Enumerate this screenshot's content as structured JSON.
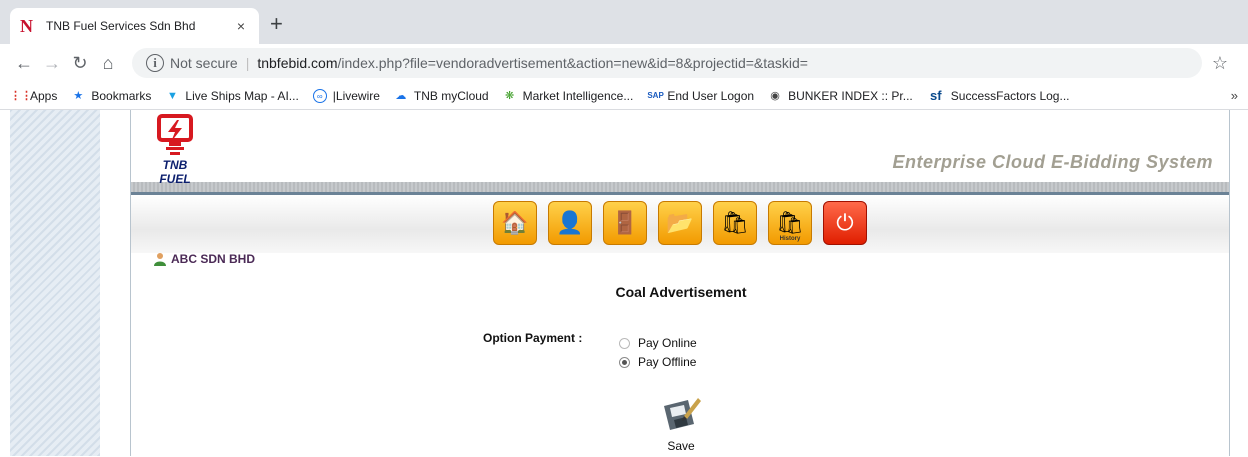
{
  "browser": {
    "tab_title": "TNB Fuel Services Sdn Bhd",
    "tab_favicon": "N",
    "close_glyph": "×",
    "newtab_glyph": "+",
    "security_label": "Not secure",
    "url_host": "tnbfebid.com",
    "url_path": "/index.php?file=vendoradvertisement&action=new&id=8&projectid=&taskid=",
    "bookmarks": [
      {
        "label": "Apps",
        "icon": "apps-grid-icon"
      },
      {
        "label": "Bookmarks",
        "icon": "star-icon"
      },
      {
        "label": "Live Ships Map - AI...",
        "icon": "ship-icon"
      },
      {
        "label": "|Livewire",
        "icon": "livewire-icon"
      },
      {
        "label": "TNB myCloud",
        "icon": "cloud-icon"
      },
      {
        "label": "Market Intelligence...",
        "icon": "market-icon"
      },
      {
        "label": "End User Logon",
        "icon": "sap-icon"
      },
      {
        "label": "BUNKER INDEX :: Pr...",
        "icon": "globe-icon"
      },
      {
        "label": "SuccessFactors Log...",
        "icon": "sf-icon"
      }
    ],
    "more_glyph": "»"
  },
  "header": {
    "brand": "TNB FUEL",
    "system_title": "Enterprise Cloud E-Bidding System"
  },
  "menu": [
    {
      "name": "home-icon",
      "glyph": "🏠",
      "caption": ""
    },
    {
      "name": "profile-icon",
      "glyph": "👤",
      "caption": ""
    },
    {
      "name": "door-icon",
      "glyph": "🚪",
      "caption": ""
    },
    {
      "name": "folder-icon",
      "glyph": "📂",
      "caption": ""
    },
    {
      "name": "bag-icon",
      "glyph": "🛍",
      "caption": ""
    },
    {
      "name": "history-icon",
      "glyph": "🛍",
      "caption": "History"
    },
    {
      "name": "power-icon",
      "glyph": "⏻",
      "caption": ""
    }
  ],
  "user": {
    "company": "ABC SDN BHD"
  },
  "form": {
    "title": "Coal Advertisement",
    "option_label": "Option Payment :",
    "options": [
      {
        "label": "Pay Online",
        "selected": false
      },
      {
        "label": "Pay Offline",
        "selected": true
      }
    ],
    "save_label": "Save"
  }
}
